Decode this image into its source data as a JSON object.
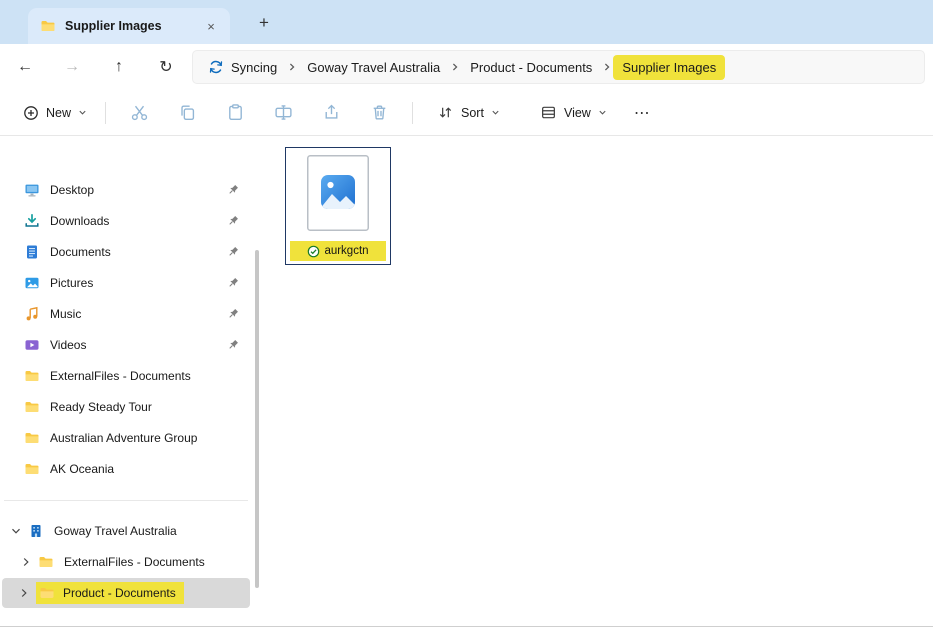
{
  "colors": {
    "highlight_yellow": "#f0e23b",
    "tab_bar_blue": "#cde2f5",
    "selected_row_gray": "#d9d9d9",
    "sync_check_green": "#187a28",
    "selection_border": "#1f3864",
    "folder_yellow": "#f8c944"
  },
  "window": {
    "tab_title": "Supplier Images",
    "close_glyph": "×",
    "new_tab_glyph": "+"
  },
  "nav_icons": {
    "back": "←",
    "forward": "→",
    "up": "↑",
    "refresh": "↻"
  },
  "breadcrumb": {
    "sync_label": "Syncing",
    "items": [
      {
        "label": "Goway Travel Australia",
        "highlighted": false
      },
      {
        "label": "Product - Documents",
        "highlighted": false
      },
      {
        "label": "Supplier Images",
        "highlighted": true
      }
    ]
  },
  "toolbar": {
    "new_label": "New",
    "sort_label": "Sort",
    "view_label": "View",
    "more_glyph": "⋯"
  },
  "sidebar": {
    "quick_access": [
      {
        "label": "Desktop",
        "icon": "desktop-icon",
        "pinned": true
      },
      {
        "label": "Downloads",
        "icon": "downloads-icon",
        "pinned": true
      },
      {
        "label": "Documents",
        "icon": "documents-icon",
        "pinned": true
      },
      {
        "label": "Pictures",
        "icon": "pictures-icon",
        "pinned": true
      },
      {
        "label": "Music",
        "icon": "music-icon",
        "pinned": true
      },
      {
        "label": "Videos",
        "icon": "videos-icon",
        "pinned": true
      },
      {
        "label": "ExternalFiles - Documents",
        "icon": "folder-icon",
        "pinned": false
      },
      {
        "label": "Ready Steady Tour",
        "icon": "folder-icon",
        "pinned": false
      },
      {
        "label": "Australian Adventure Group",
        "icon": "folder-icon",
        "pinned": false
      },
      {
        "label": "AK Oceania",
        "icon": "folder-icon",
        "pinned": false
      }
    ],
    "tree": {
      "root_label": "Goway Travel Australia",
      "root_expanded": true,
      "children": [
        {
          "label": "ExternalFiles - Documents",
          "selected": false,
          "highlighted": false
        },
        {
          "label": "Product - Documents",
          "selected": true,
          "highlighted": true
        }
      ]
    }
  },
  "content": {
    "files": [
      {
        "name": "aurkgctn",
        "type": "image",
        "sync_status": "synced",
        "selected": true,
        "highlighted": true
      }
    ]
  }
}
